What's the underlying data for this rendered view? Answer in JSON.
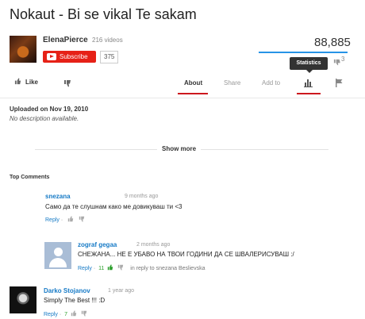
{
  "video": {
    "title": "Nokaut - Bi se vikal Te sakam",
    "view_count": "88,885",
    "dislike_count": "3",
    "like_ratio": 0.97
  },
  "channel": {
    "name": "ElenaPierce",
    "video_count": "216 videos",
    "subscribe_label": "Subscribe",
    "subscriber_count": "375"
  },
  "actions": {
    "like_label": "Like",
    "tabs": [
      "About",
      "Share",
      "Add to"
    ],
    "statistics_tooltip": "Statistics"
  },
  "about": {
    "upload_date": "Uploaded on Nov 19, 2010",
    "description": "No description available.",
    "show_more": "Show more"
  },
  "comments": {
    "heading": "Top Comments",
    "items": [
      {
        "user": "snezana",
        "time": "9 months ago",
        "text": "Само да те слушнам како ме довикуваш ти <3",
        "reply_label": "Reply",
        "sep": "·"
      },
      {
        "user": "zograf gegaa",
        "time": "2 months ago",
        "text": "СНЕЖАНА... НЕ Е УБАВО НА ТВОИ ГОДИНИ ДА СЕ ШВАЛЕРИСУВАШ :/",
        "reply_label": "Reply",
        "sep": "·",
        "likes": "11",
        "in_reply_to": "in reply to snezana Beslievska"
      },
      {
        "user": "Darko Stojanov",
        "time": "1 year ago",
        "text": "Simply The Best !!! :D",
        "reply_label": "Reply",
        "sep": "·",
        "likes": "7"
      }
    ]
  },
  "colors": {
    "subscribe": "#e62117",
    "link": "#167ac6",
    "tab_active_underline": "#cc181e",
    "like_bar": "#2793e6"
  },
  "icons": [
    "thumbs-up-icon",
    "thumbs-down-icon",
    "statistics-icon",
    "flag-icon",
    "youtube-play-icon"
  ]
}
